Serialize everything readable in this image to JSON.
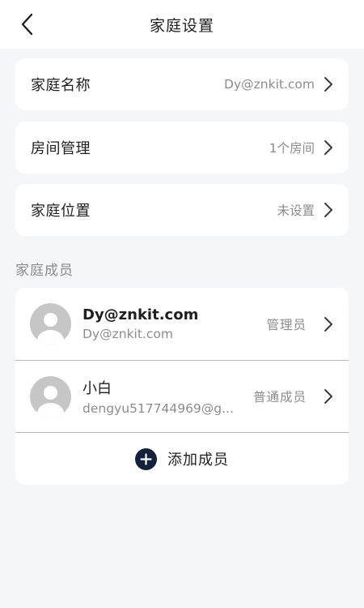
{
  "header": {
    "title": "家庭设置"
  },
  "settings": {
    "name": {
      "label": "家庭名称",
      "value": "Dy@znkit.com"
    },
    "rooms": {
      "label": "房间管理",
      "value": "1个房间"
    },
    "location": {
      "label": "家庭位置",
      "value": "未设置"
    }
  },
  "members_section": {
    "title": "家庭成员",
    "members": [
      {
        "name": "Dy@znkit.com",
        "account": "Dy@znkit.com",
        "role": "管理员"
      },
      {
        "name": "小白",
        "account": "dengyu517744969@g...",
        "role": "普通成员"
      }
    ],
    "add_label": "添加成员"
  },
  "colors": {
    "background": "#f5f6f8",
    "card": "#ffffff",
    "accent": "#14213d",
    "secondary_text": "#8c8c8c"
  },
  "icons": [
    "back-arrow-icon",
    "chevron-right-icon",
    "avatar-placeholder-icon",
    "plus-circle-icon"
  ]
}
